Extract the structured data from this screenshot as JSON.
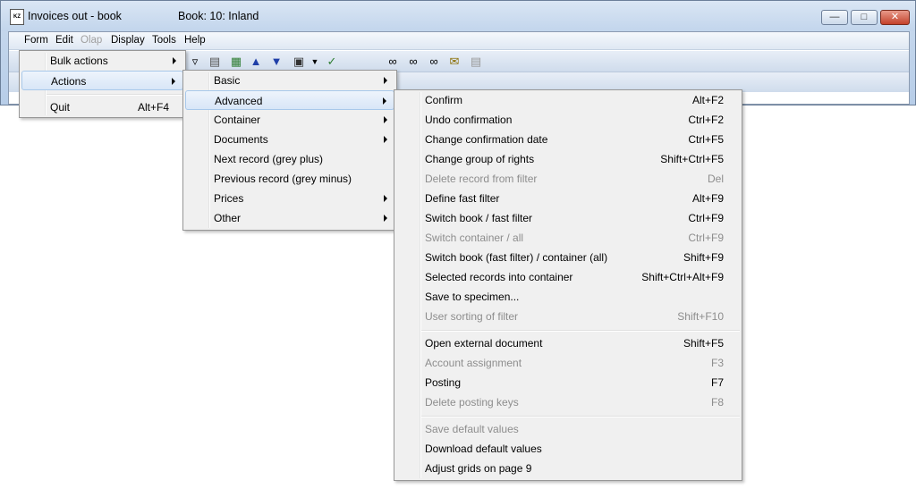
{
  "window": {
    "title": "Invoices out - book",
    "book": "Book: 10: Inland",
    "icon_text": "KZ",
    "min_icon": "minimize-icon",
    "max_icon": "maximize-icon",
    "close_icon": "close-icon"
  },
  "menubar": {
    "items": [
      "Form",
      "Edit",
      "Olap",
      "Display",
      "Tools",
      "Help"
    ]
  },
  "toolbar": {
    "icons": [
      "filter-icon",
      "document-filter-icon",
      "stack-icon",
      "arrow-up-icon",
      "arrow-down-icon",
      "camera-icon",
      "dropdown-arrow-icon",
      "checkmark-icon",
      "binoculars-icon",
      "binoculars-next-icon",
      "binoculars-prev-icon",
      "envelope-icon",
      "attachment-icon"
    ]
  },
  "form_menu": {
    "items": [
      {
        "label": "Bulk actions",
        "submenu": true
      },
      {
        "label": "Actions",
        "submenu": true,
        "selected": true
      },
      {
        "label": "Quit",
        "shortcut": "Alt+F4"
      }
    ]
  },
  "actions_menu": {
    "items": [
      {
        "label": "Basic",
        "submenu": true
      },
      {
        "label": "Advanced",
        "submenu": true,
        "selected": true
      },
      {
        "label": "Container",
        "submenu": true
      },
      {
        "label": "Documents",
        "submenu": true
      },
      {
        "label": "Next record (grey plus)"
      },
      {
        "label": "Previous record (grey minus)"
      },
      {
        "label": "Prices",
        "submenu": true
      },
      {
        "label": "Other",
        "submenu": true
      }
    ]
  },
  "advanced_menu": {
    "items": [
      {
        "label": "Confirm",
        "shortcut": "Alt+F2"
      },
      {
        "label": "Undo confirmation",
        "shortcut": "Ctrl+F2"
      },
      {
        "label": "Change confirmation date",
        "shortcut": "Ctrl+F5"
      },
      {
        "label": "Change group of rights",
        "shortcut": "Shift+Ctrl+F5"
      },
      {
        "label": "Delete record from filter",
        "shortcut": "Del",
        "disabled": true
      },
      {
        "label": "Define fast filter",
        "shortcut": "Alt+F9"
      },
      {
        "label": "Switch book / fast filter",
        "shortcut": "Ctrl+F9"
      },
      {
        "label": "Switch container / all",
        "shortcut": "Ctrl+F9",
        "disabled": true
      },
      {
        "label": "Switch book (fast filter) / container (all)",
        "shortcut": "Shift+F9"
      },
      {
        "label": "Selected records into container",
        "shortcut": "Shift+Ctrl+Alt+F9"
      },
      {
        "label": "Save to specimen...",
        "shortcut": ""
      },
      {
        "label": "User sorting of filter",
        "shortcut": "Shift+F10",
        "disabled": true
      },
      {
        "label": "Open external document",
        "shortcut": "Shift+F5"
      },
      {
        "label": "Account assignment",
        "shortcut": "F3",
        "disabled": true
      },
      {
        "label": "Posting",
        "shortcut": "F7"
      },
      {
        "label": "Delete posting keys",
        "shortcut": "F8",
        "disabled": true
      },
      {
        "label": "Save default values",
        "shortcut": "",
        "disabled": true
      },
      {
        "label": "Download default values",
        "shortcut": ""
      },
      {
        "label": "Adjust grids on page 9",
        "shortcut": ""
      }
    ]
  }
}
